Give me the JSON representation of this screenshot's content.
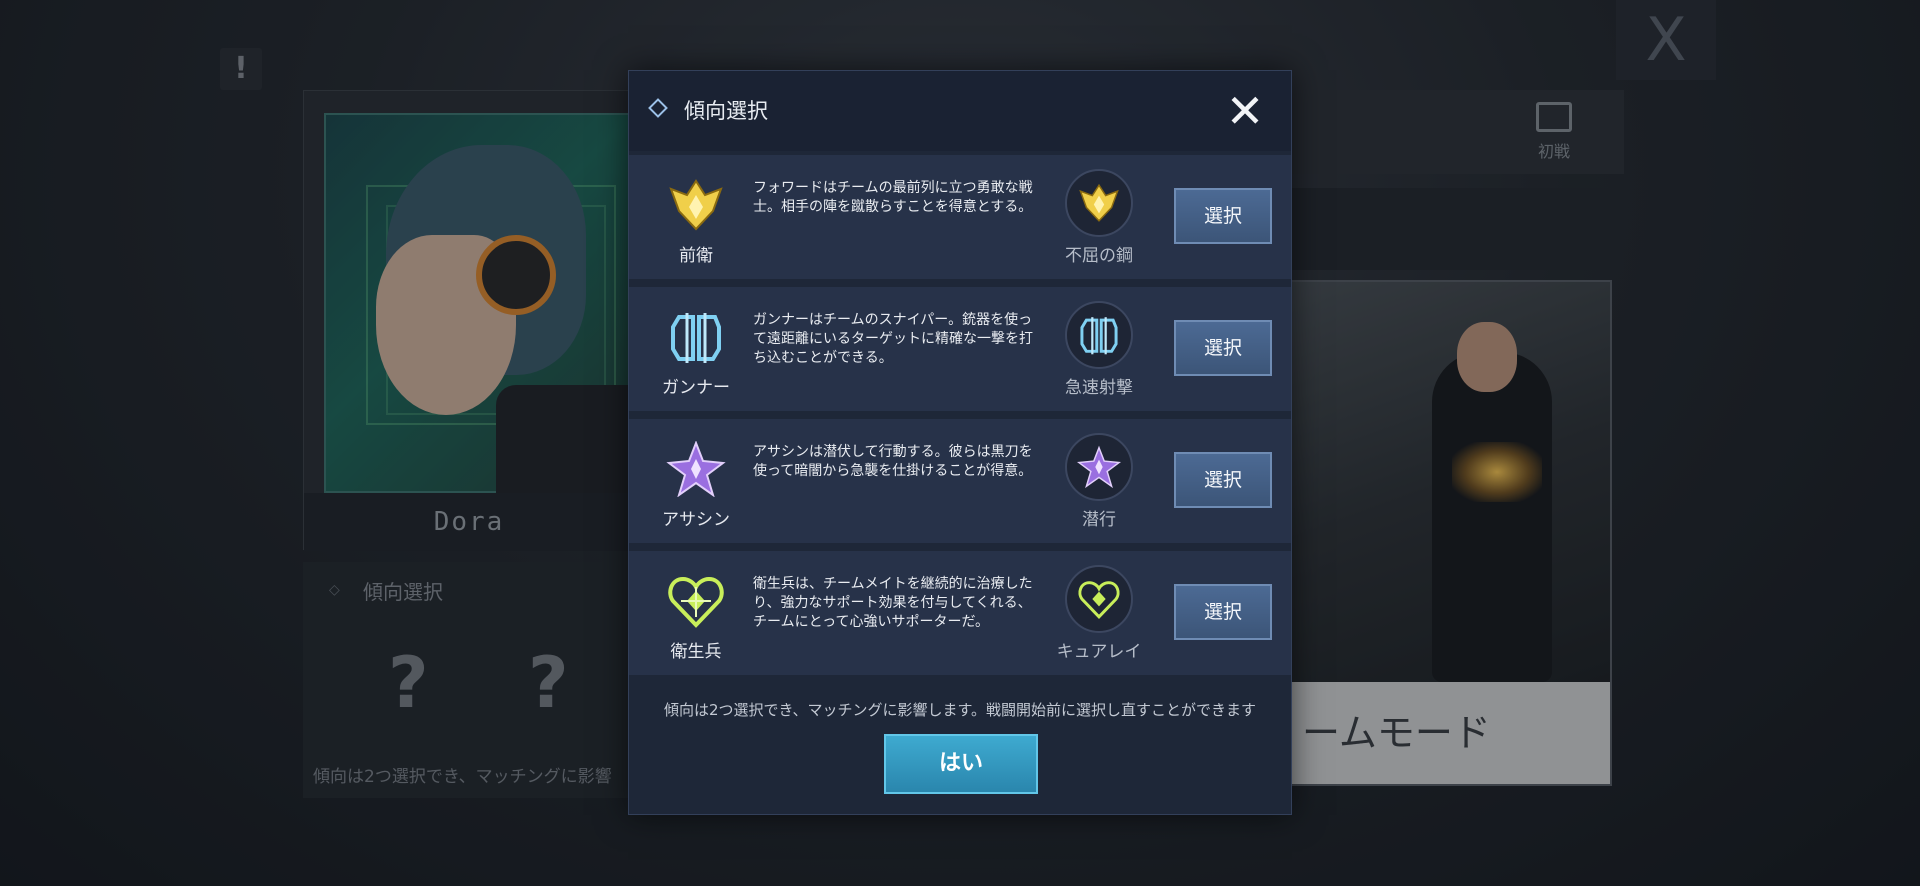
{
  "background": {
    "alert_symbol": "!",
    "character_name": "Dora",
    "tendency_title": "傾向選択",
    "placeholder_mark": "?",
    "tendency_note": "傾向は2つ選択でき、マッチングに影響",
    "gift_label": "初戦",
    "mode_label": "ームモード",
    "close_symbol": "X"
  },
  "modal": {
    "title": "傾向選択",
    "close_symbol": "✕",
    "rows": [
      {
        "class_name": "前衛",
        "desc": "フォワードはチームの最前列に立つ勇敢な戦士。相手の陣を蹴散らすことを得意とする。",
        "skill_name": "不屈の鋼",
        "button_label": "選択",
        "icon": "crown-shield-icon",
        "color": "#f0cf4a"
      },
      {
        "class_name": "ガンナー",
        "desc": "ガンナーはチームのスナイパー。銃器を使って遠距離にいるターゲットに精確な一撃を打ち込むことができる。",
        "skill_name": "急速射撃",
        "button_label": "選択",
        "icon": "gunner-emblem-icon",
        "color": "#7fd0f2"
      },
      {
        "class_name": "アサシン",
        "desc": "アサシンは潜伏して行動する。彼らは黒刀を使って暗闇から急襲を仕掛けることが得意。",
        "skill_name": "潜行",
        "button_label": "選択",
        "icon": "assassin-star-icon",
        "color": "#b98df0"
      },
      {
        "class_name": "衛生兵",
        "desc": "衛生兵は、チームメイトを継続的に治療したり、強力なサポート効果を付与してくれる、チームにとって心強いサポーターだ。",
        "skill_name": "キュアレイ",
        "button_label": "選択",
        "icon": "medic-heart-icon",
        "color": "#c8ee5a"
      }
    ],
    "note": "傾向は2つ選択でき、マッチングに影響します。戦闘開始前に選択し直すことができます",
    "confirm_label": "はい"
  }
}
